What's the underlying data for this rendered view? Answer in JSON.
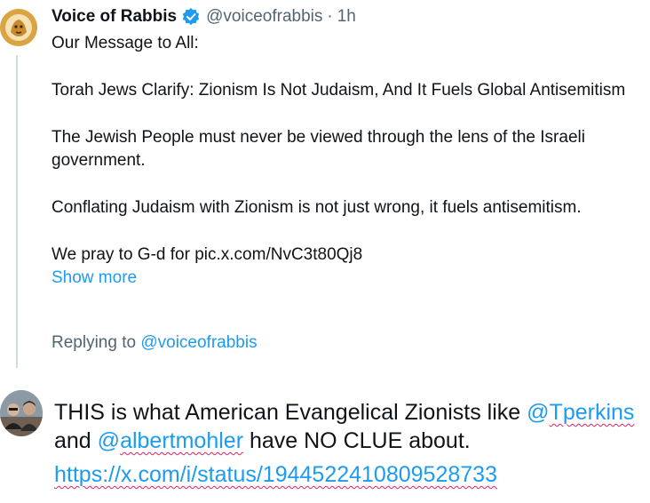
{
  "tweet": {
    "display_name": "Voice of Rabbis",
    "handle": "@voiceofrabbis",
    "separator": "·",
    "time": "1h",
    "lines": [
      "Our Message to All:",
      "Torah Jews Clarify: Zionism Is Not Judaism, And It Fuels Global Antisemitism",
      "The Jewish People must never be viewed through the lens of the Israeli government.",
      "Conflating Judaism with Zionism is not just wrong, it fuels antisemitism.",
      "We pray to G-d for pic.x.com/NvC3t80Qj8"
    ],
    "show_more": "Show more"
  },
  "replying": {
    "prefix": "Replying to ",
    "mention": "@voiceofrabbis"
  },
  "reply": {
    "text_1": "THIS is what American Evangelical Zionists like ",
    "mention_1_at": "@",
    "mention_1_name": "Tperkins",
    "text_2": " and ",
    "mention_2_at": "@",
    "mention_2_name": "albertmohler",
    "text_3": " have NO CLUE about.",
    "url": "https://x.com/i/status/1944522410809528733"
  },
  "colors": {
    "accent": "#1d9bf0",
    "muted": "#536471",
    "thread_line": "#cfd9de",
    "spellcheck": "#e0245e"
  },
  "icons": {
    "verified": "verified-badge-icon",
    "avatar_top": "lion-logo-avatar",
    "avatar_bottom": "user-photo-avatar"
  }
}
